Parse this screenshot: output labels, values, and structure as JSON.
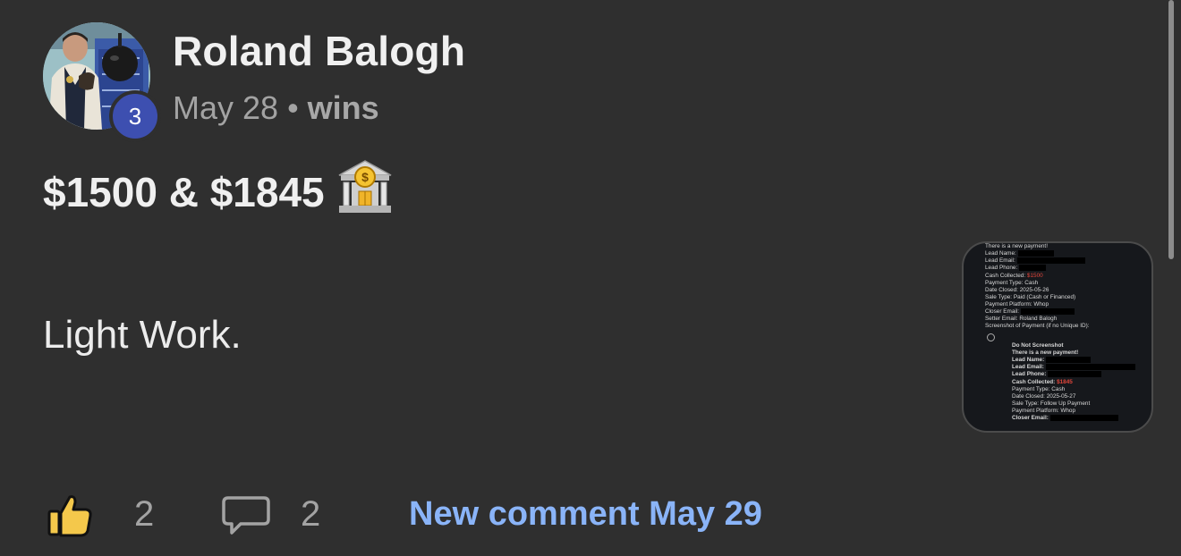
{
  "post": {
    "author": "Roland Balogh",
    "level": "3",
    "date": "May 28",
    "separator": "•",
    "category": "wins",
    "title": "$1500 & $1845",
    "title_icon": "bank-icon",
    "body": "Light Work."
  },
  "thumbnail": {
    "first": {
      "header": "There is a new payment!",
      "lead_name": "Lead Name:",
      "lead_email": "Lead Email:",
      "lead_phone": "Lead Phone:",
      "cash_label": "Cash Collected:",
      "cash_value": "$1500",
      "payment_type": "Payment Type: Cash",
      "date_closed": "Date Closed: 2025-05-26",
      "sale_type": "Sale Type: Paid (Cash or Financed)",
      "platform": "Payment Platform: Whop",
      "closer_email": "Closer Email:",
      "setter_email": "Setter Email:  Roland Balogh",
      "screenshot": "Screenshot of Payment (if no Unique ID):"
    },
    "second": {
      "do_not": "Do Not Screenshot",
      "header": "There is a new payment!",
      "lead_name": "Lead Name:",
      "lead_email": "Lead Email:",
      "lead_phone": "Lead Phone:",
      "cash_label": "Cash Collected:",
      "cash_value": "$1845",
      "payment_type": "Payment Type: Cash",
      "date_closed": "Date Closed: 2025-05-27",
      "sale_type": "Sale Type: Follow Up Payment",
      "platform": "Payment Platform: Whop",
      "closer_email": "Closer Email:"
    }
  },
  "footer": {
    "like_icon": "thumbs-up-icon",
    "likes": "2",
    "comment_icon": "comment-bubble-icon",
    "comments": "2",
    "new_comment": "New comment May 29"
  },
  "colors": {
    "background": "#2f2f2f",
    "level_badge": "#3d4fb0",
    "link": "#8ab4f8",
    "muted_text": "#a3a3a3"
  }
}
